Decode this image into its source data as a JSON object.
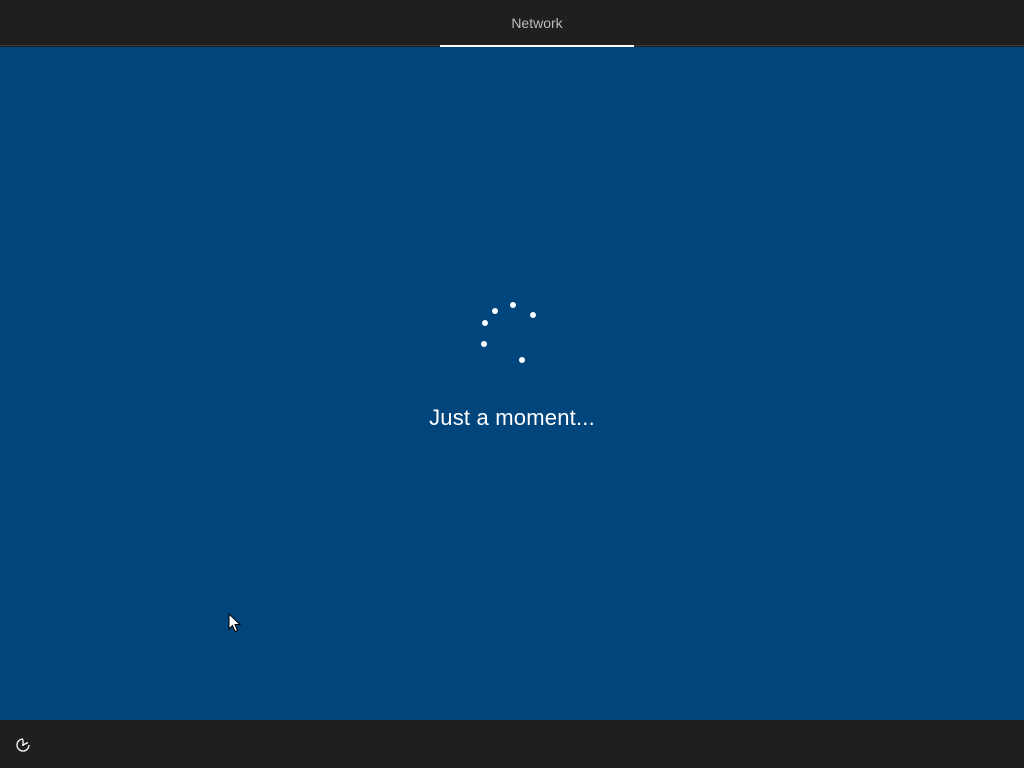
{
  "header": {
    "active_tab": "Network"
  },
  "main": {
    "status_text": "Just a moment..."
  },
  "footer": {
    "accessibility_icon": "ease-of-access-icon"
  },
  "colors": {
    "background_blue": "#00457c",
    "chrome_dark": "#1f1f1f",
    "text_white": "#ffffff",
    "tab_text": "#bdbdbd"
  }
}
